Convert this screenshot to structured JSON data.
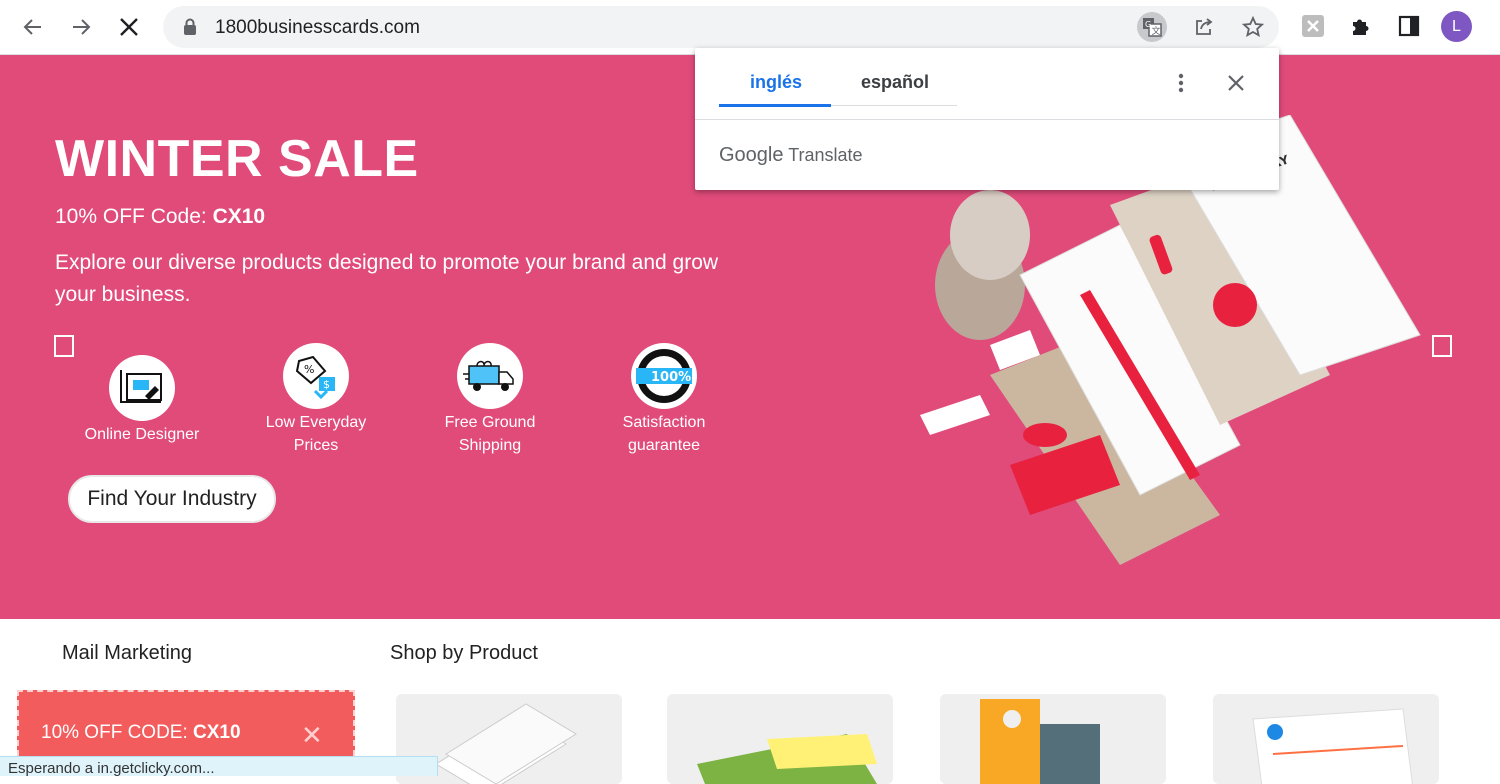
{
  "browser": {
    "url": "1800businesscards.com",
    "profile_initial": "L",
    "icons": [
      "back-icon",
      "forward-icon",
      "stop-icon",
      "lock-icon",
      "translate-icon",
      "share-icon",
      "star-icon",
      "extension-x-icon",
      "puzzle-icon",
      "side-panel-icon"
    ]
  },
  "translate_popup": {
    "tab_source": "inglés",
    "tab_target": "español",
    "footer_brand": "Google",
    "footer_product": "Translate"
  },
  "hero": {
    "title": "WINTER SALE",
    "code_label": "10% OFF Code: ",
    "code_value": "CX10",
    "description": "Explore our diverse products designed to promote your brand and grow your business.",
    "features": [
      {
        "label_line1": "Online Designer",
        "label_line2": "",
        "icon": "online-designer-icon"
      },
      {
        "label_line1": "Low Everyday",
        "label_line2": "Prices",
        "icon": "price-tag-icon"
      },
      {
        "label_line1": "Free Ground",
        "label_line2": "Shipping",
        "icon": "delivery-truck-icon"
      },
      {
        "label_line1": "Satisfaction",
        "label_line2": "guarantee",
        "icon": "guarantee-badge-icon"
      }
    ],
    "cta": "Find Your Industry",
    "accent": "#e04b7a"
  },
  "menu": {
    "item1": "Mail Marketing",
    "item2": "Shop by Product"
  },
  "promo": {
    "text_prefix": "10% OFF CODE: ",
    "text_code": "CX10",
    "close": "✕"
  },
  "status_bar": "Esperando a in.getclicky.com..."
}
